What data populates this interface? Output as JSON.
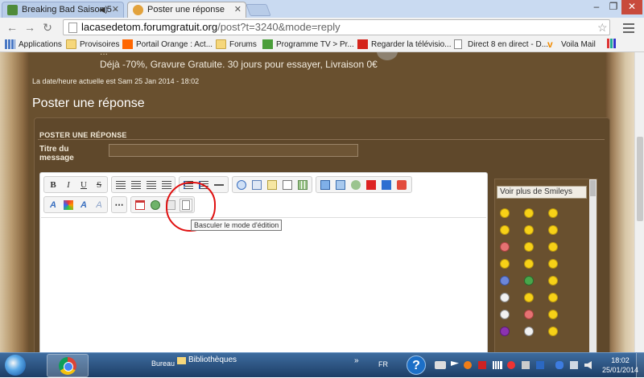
{
  "browser": {
    "tabs": [
      {
        "title": "Breaking Bad Saison 5 -",
        "active": false
      },
      {
        "title": "Poster une réponse",
        "active": true
      }
    ],
    "url_domain": "lacasedetom.forumgratuit.org",
    "url_path": "/post?t=3240&mode=reply",
    "bookmarks": [
      {
        "label": "Applications",
        "icon": "apps-grid-icon"
      },
      {
        "label": "Provisoires",
        "icon": "folder-icon"
      },
      {
        "label": "Portail Orange : Act...",
        "icon": "orange-icon"
      },
      {
        "label": "Forums",
        "icon": "folder-icon"
      },
      {
        "label": "Programme TV > Pr...",
        "icon": "tv-icon"
      },
      {
        "label": "Regarder la télévisio...",
        "icon": "tv-icon"
      },
      {
        "label": "Direct 8 en direct - D...",
        "icon": "page-icon"
      },
      {
        "label": "Voila Mail",
        "icon": "voila-icon"
      }
    ]
  },
  "page": {
    "ad_line_1": "...",
    "ad_line_2": "Déjà -70%, Gravure Gratuite. 30 jours pour essayer, Livraison 0€",
    "datetime": "La date/heure actuelle est Sam 25 Jan 2014 - 18:02",
    "title": "Poster une réponse",
    "form_header": "POSTER UNE RÉPONSE",
    "subject_label": "Titre du message",
    "subject_value": "",
    "tooltip": "Basculer le mode d'édition",
    "smileys_header": "Voir plus de Smileys"
  },
  "taskbar": {
    "bureau": "Bureau",
    "bibliotheques": "Bibliothèques",
    "language": "FR",
    "time": "18:02",
    "date": "25/01/2014"
  }
}
